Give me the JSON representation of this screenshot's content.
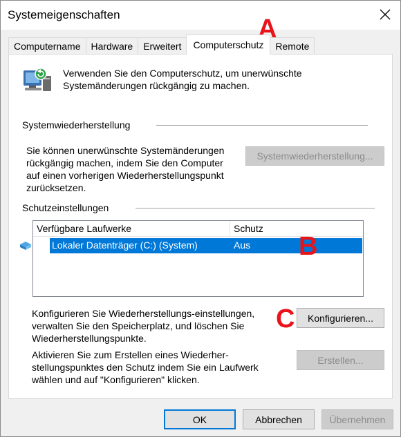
{
  "window": {
    "title": "Systemeigenschaften"
  },
  "tabs": [
    {
      "label": "Computername",
      "active": false
    },
    {
      "label": "Hardware",
      "active": false
    },
    {
      "label": "Erweitert",
      "active": false
    },
    {
      "label": "Computerschutz",
      "active": true
    },
    {
      "label": "Remote",
      "active": false
    }
  ],
  "intro": {
    "text": "Verwenden Sie den Computerschutz, um unerwünschte Systemänderungen rückgängig zu machen."
  },
  "restore_group": {
    "title": "Systemwiederherstellung",
    "text": "Sie können unerwünschte Systemänderungen rückgängig machen, indem Sie den Computer auf einen vorherigen Wiederherstellungspunkt zurücksetzen.",
    "button_label": "Systemwiederherstellung..."
  },
  "protection_group": {
    "title": "Schutzeinstellungen",
    "columns": [
      "Verfügbare Laufwerke",
      "Schutz"
    ],
    "rows": [
      {
        "drive": "Lokaler Datenträger (C:) (System)",
        "status": "Aus",
        "selected": true
      }
    ],
    "configure_text": "Konfigurieren Sie Wiederherstellungs-einstellungen, verwalten Sie den Speicherplatz, und löschen Sie Wiederherstellungspunkte.",
    "configure_button": "Konfigurieren...",
    "create_text": "Aktivieren Sie zum Erstellen eines Wiederher-stellungspunktes den Schutz indem Sie ein Laufwerk wählen und auf \"Konfigurieren\" klicken.",
    "create_button": "Erstellen..."
  },
  "footer": {
    "ok": "OK",
    "cancel": "Abbrechen",
    "apply": "Übernehmen"
  },
  "markers": {
    "a": "A",
    "b": "B",
    "c": "C"
  },
  "colors": {
    "selection": "#0078d7",
    "marker": "#e8131b"
  }
}
